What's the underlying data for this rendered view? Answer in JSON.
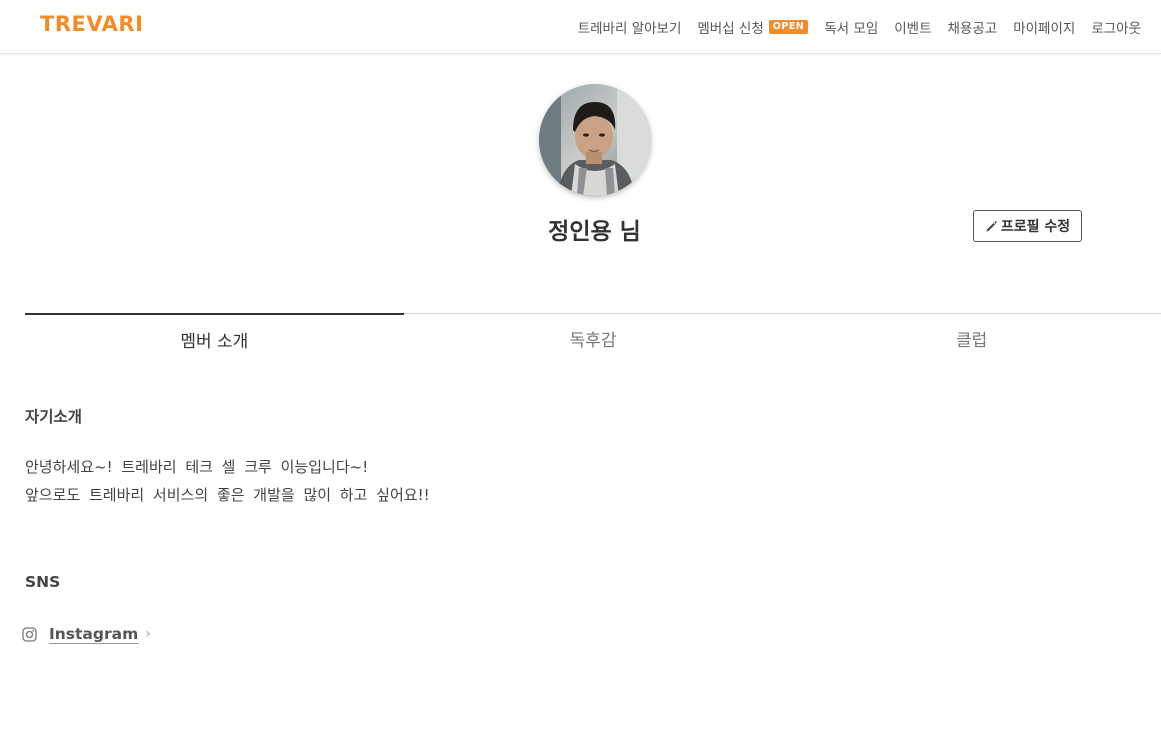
{
  "header": {
    "logo": "TREVARI",
    "nav": [
      {
        "label": "트레바리 알아보기"
      },
      {
        "label": "멤버십 신청",
        "badge": "OPEN"
      },
      {
        "label": "독서 모임"
      },
      {
        "label": "이벤트"
      },
      {
        "label": "채용공고"
      },
      {
        "label": "마이페이지"
      },
      {
        "label": "로그아웃"
      }
    ]
  },
  "profile": {
    "name": "정인용 님",
    "edit_label": "프로필 수정",
    "avatar_icon": "profile-photo"
  },
  "tabs": [
    "멤버 소개",
    "독후감",
    "클럽"
  ],
  "about": {
    "title": "자기소개",
    "lines": [
      "안녕하세요~! 트레바리 테크 셀 크루 이능입니다~!",
      "앞으로도 트레바리 서비스의 좋은 개발을 많이 하고 싶어요!!"
    ]
  },
  "sns": {
    "title": "SNS",
    "items": [
      {
        "label": "Instagram",
        "icon": "instagram-icon"
      }
    ]
  },
  "colors": {
    "brand": "#f08c2a",
    "text": "#333333"
  }
}
